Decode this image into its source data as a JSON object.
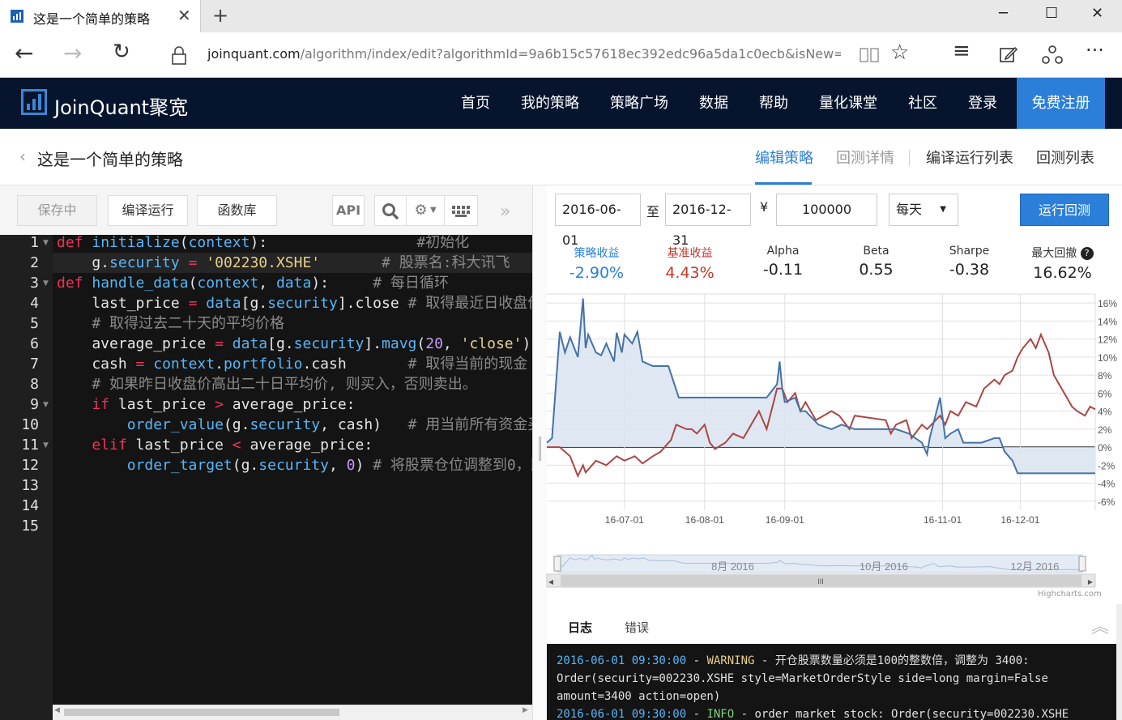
{
  "browser": {
    "tab_title": "这是一个简单的策略",
    "url_host": "joinquant.com",
    "url_path": "/algorithm/index/edit?algorithmId=9a6b15c57618ec392edc96a5da1c0ecb&isNew=1&type=&f=&"
  },
  "site": {
    "logo_text": "JoinQuant聚宽",
    "nav": [
      "首页",
      "我的策略",
      "策略广场",
      "数据",
      "帮助",
      "量化课堂",
      "社区",
      "登录"
    ],
    "signup": "免费注册"
  },
  "strategy": {
    "name": "这是一个简单的策略",
    "tabs": [
      "编辑策略",
      "回测详情",
      "编译运行列表",
      "回测列表"
    ]
  },
  "toolbar": {
    "save": "保存中",
    "compile_run": "编译运行",
    "library": "函数库",
    "api": "API"
  },
  "editor": {
    "line_numbers": [
      "1",
      "2",
      "3",
      "4",
      "5",
      "6",
      "7",
      "8",
      "9",
      "10",
      "11",
      "12",
      "13",
      "14",
      "15"
    ]
  },
  "backtest": {
    "start_date": "2016-06-01",
    "to_label": "至",
    "end_date": "2016-12-31",
    "currency_symbol": "¥",
    "capital": "100000",
    "frequency": "每天",
    "run_button": "运行回测"
  },
  "metrics": [
    {
      "label": "策略收益",
      "value": "-2.90%"
    },
    {
      "label": "基准收益",
      "value": "4.43%"
    },
    {
      "label": "Alpha",
      "value": "-0.11"
    },
    {
      "label": "Beta",
      "value": "0.55"
    },
    {
      "label": "Sharpe",
      "value": "-0.38"
    },
    {
      "label": "最大回撤",
      "value": "16.62%"
    }
  ],
  "chart_data": {
    "type": "line",
    "ylim": [
      -7,
      17
    ],
    "y_ticks": [
      "16%",
      "14%",
      "12%",
      "10%",
      "8%",
      "6%",
      "4%",
      "2%",
      "0%",
      "-2%",
      "-4%",
      "-6%"
    ],
    "y_tick_values": [
      16,
      14,
      12,
      10,
      8,
      6,
      4,
      2,
      0,
      -2,
      -4,
      -6
    ],
    "x_tick_labels": [
      "16-07-01",
      "16-08-01",
      "16-09-01",
      "16-11-01",
      "16-12-01"
    ],
    "x_tick_dates": [
      "2016-07-01",
      "2016-08-01",
      "2016-09-01",
      "2016-11-01",
      "2016-12-01"
    ],
    "x_range": [
      "2016-06-01",
      "2016-12-30"
    ],
    "grid": true,
    "colors": {
      "strategy": "#4572a7",
      "benchmark": "#aa4643",
      "area": "#dbe5f1"
    },
    "series": [
      {
        "points": [
          [
            "2016-06-01",
            0.5
          ],
          [
            "2016-06-03",
            1.0
          ],
          [
            "2016-06-06",
            12.8
          ],
          [
            "2016-06-08",
            10.5
          ],
          [
            "2016-06-10",
            12.2
          ],
          [
            "2016-06-13",
            10.0
          ],
          [
            "2016-06-15",
            16.5
          ],
          [
            "2016-06-16",
            11.0
          ],
          [
            "2016-06-17",
            12.5
          ],
          [
            "2016-06-20",
            10.5
          ],
          [
            "2016-06-22",
            10.2
          ],
          [
            "2016-06-24",
            11.5
          ],
          [
            "2016-06-27",
            9.5
          ],
          [
            "2016-06-28",
            12.7
          ],
          [
            "2016-06-30",
            10.5
          ],
          [
            "2016-07-01",
            12.5
          ],
          [
            "2016-07-04",
            11.5
          ],
          [
            "2016-07-06",
            12.8
          ],
          [
            "2016-07-08",
            9.5
          ],
          [
            "2016-07-12",
            9.0
          ],
          [
            "2016-07-18",
            9.0
          ],
          [
            "2016-07-22",
            5.5
          ],
          [
            "2016-07-28",
            5.5
          ],
          [
            "2016-08-05",
            5.5
          ],
          [
            "2016-08-15",
            5.5
          ],
          [
            "2016-08-25",
            5.5
          ],
          [
            "2016-08-29",
            7.0
          ],
          [
            "2016-08-30",
            9.5
          ],
          [
            "2016-08-31",
            6.5
          ],
          [
            "2016-09-01",
            5.0
          ],
          [
            "2016-09-05",
            5.5
          ],
          [
            "2016-09-07",
            4.0
          ],
          [
            "2016-09-09",
            4.0
          ],
          [
            "2016-09-14",
            2.5
          ],
          [
            "2016-09-19",
            2.0
          ],
          [
            "2016-09-23",
            2.5
          ],
          [
            "2016-09-28",
            2.0
          ],
          [
            "2016-10-10",
            2.0
          ],
          [
            "2016-10-14",
            2.0
          ],
          [
            "2016-10-19",
            1.5
          ],
          [
            "2016-10-24",
            0.5
          ],
          [
            "2016-10-26",
            -0.8
          ],
          [
            "2016-10-27",
            1.0
          ],
          [
            "2016-10-31",
            5.5
          ],
          [
            "2016-11-02",
            1.0
          ],
          [
            "2016-11-04",
            1.5
          ],
          [
            "2016-11-07",
            2.0
          ],
          [
            "2016-11-09",
            0.5
          ],
          [
            "2016-11-11",
            0.5
          ],
          [
            "2016-11-16",
            0.5
          ],
          [
            "2016-11-21",
            1.0
          ],
          [
            "2016-11-23",
            1.0
          ],
          [
            "2016-11-25",
            -0.5
          ],
          [
            "2016-11-28",
            -1.5
          ],
          [
            "2016-11-30",
            -2.9
          ],
          [
            "2016-12-05",
            -2.9
          ],
          [
            "2016-12-15",
            -2.9
          ],
          [
            "2016-12-30",
            -2.9
          ]
        ]
      },
      {
        "points": [
          [
            "2016-06-01",
            0.0
          ],
          [
            "2016-06-06",
            0.0
          ],
          [
            "2016-06-08",
            -0.5
          ],
          [
            "2016-06-10",
            -1.0
          ],
          [
            "2016-06-13",
            -3.2
          ],
          [
            "2016-06-15",
            -2.0
          ],
          [
            "2016-06-16",
            -2.8
          ],
          [
            "2016-06-20",
            -1.5
          ],
          [
            "2016-06-24",
            -2.0
          ],
          [
            "2016-06-28",
            -1.0
          ],
          [
            "2016-07-01",
            -1.5
          ],
          [
            "2016-07-05",
            -1.0
          ],
          [
            "2016-07-08",
            -1.8
          ],
          [
            "2016-07-12",
            -1.0
          ],
          [
            "2016-07-15",
            -0.5
          ],
          [
            "2016-07-19",
            0.8
          ],
          [
            "2016-07-21",
            2.5
          ],
          [
            "2016-07-25",
            2.0
          ],
          [
            "2016-07-27",
            2.0
          ],
          [
            "2016-07-29",
            1.5
          ],
          [
            "2016-08-01",
            2.5
          ],
          [
            "2016-08-03",
            0.5
          ],
          [
            "2016-08-05",
            -0.2
          ],
          [
            "2016-08-09",
            0.5
          ],
          [
            "2016-08-12",
            1.5
          ],
          [
            "2016-08-16",
            1.0
          ],
          [
            "2016-08-18",
            2.0
          ],
          [
            "2016-08-22",
            4.0
          ],
          [
            "2016-08-25",
            2.0
          ],
          [
            "2016-08-29",
            6.5
          ],
          [
            "2016-08-31",
            6.5
          ],
          [
            "2016-09-02",
            5.0
          ],
          [
            "2016-09-05",
            6.0
          ],
          [
            "2016-09-07",
            4.0
          ],
          [
            "2016-09-09",
            5.0
          ],
          [
            "2016-09-13",
            3.0
          ],
          [
            "2016-09-19",
            4.0
          ],
          [
            "2016-09-22",
            3.5
          ],
          [
            "2016-09-26",
            2.0
          ],
          [
            "2016-09-28",
            3.5
          ],
          [
            "2016-10-10",
            3.0
          ],
          [
            "2016-10-12",
            1.5
          ],
          [
            "2016-10-14",
            2.5
          ],
          [
            "2016-10-18",
            3.0
          ],
          [
            "2016-10-20",
            1.0
          ],
          [
            "2016-10-24",
            2.5
          ],
          [
            "2016-10-26",
            2.0
          ],
          [
            "2016-10-31",
            3.5
          ],
          [
            "2016-11-02",
            2.5
          ],
          [
            "2016-11-04",
            4.0
          ],
          [
            "2016-11-07",
            3.5
          ],
          [
            "2016-11-10",
            5.0
          ],
          [
            "2016-11-14",
            4.5
          ],
          [
            "2016-11-17",
            6.5
          ],
          [
            "2016-11-21",
            7.5
          ],
          [
            "2016-11-23",
            7.0
          ],
          [
            "2016-11-25",
            8.0
          ],
          [
            "2016-11-28",
            8.5
          ],
          [
            "2016-11-30",
            10.0
          ],
          [
            "2016-12-02",
            11.0
          ],
          [
            "2016-12-05",
            12.0
          ],
          [
            "2016-12-07",
            11.0
          ],
          [
            "2016-12-09",
            12.5
          ],
          [
            "2016-12-12",
            10.5
          ],
          [
            "2016-12-14",
            8.0
          ],
          [
            "2016-12-16",
            7.0
          ],
          [
            "2016-12-19",
            5.5
          ],
          [
            "2016-12-21",
            4.5
          ],
          [
            "2016-12-23",
            4.0
          ],
          [
            "2016-12-26",
            3.5
          ],
          [
            "2016-12-28",
            4.5
          ],
          [
            "2016-12-30",
            4.2
          ]
        ]
      }
    ],
    "navigator": {
      "labels": [
        "8月 2016",
        "10月 2016",
        "12月 2016"
      ],
      "label_dates": [
        "2016-08-01",
        "2016-10-01",
        "2016-12-01"
      ],
      "grip": "III"
    }
  },
  "highcharts_credit": "Highcharts.com",
  "log": {
    "tabs": [
      "日志",
      "错误"
    ],
    "entry1_time": "2016-06-01 09:30:00",
    "entry1_sep": " - ",
    "entry1_level": "WARNING",
    "entry1_message": " - 开仓股票数量必须是100的整数倍，调整为 3400: Order(security=002230.XSHE style=MarketOrderStyle side=long margin=False amount=3400 action=open)",
    "entry2_time": "2016-06-01 09:30:00",
    "entry2_sep": " - ",
    "entry2_level": "INFO",
    "entry2_message": " - order_market_stock: Order(security=002230.XSHE"
  }
}
